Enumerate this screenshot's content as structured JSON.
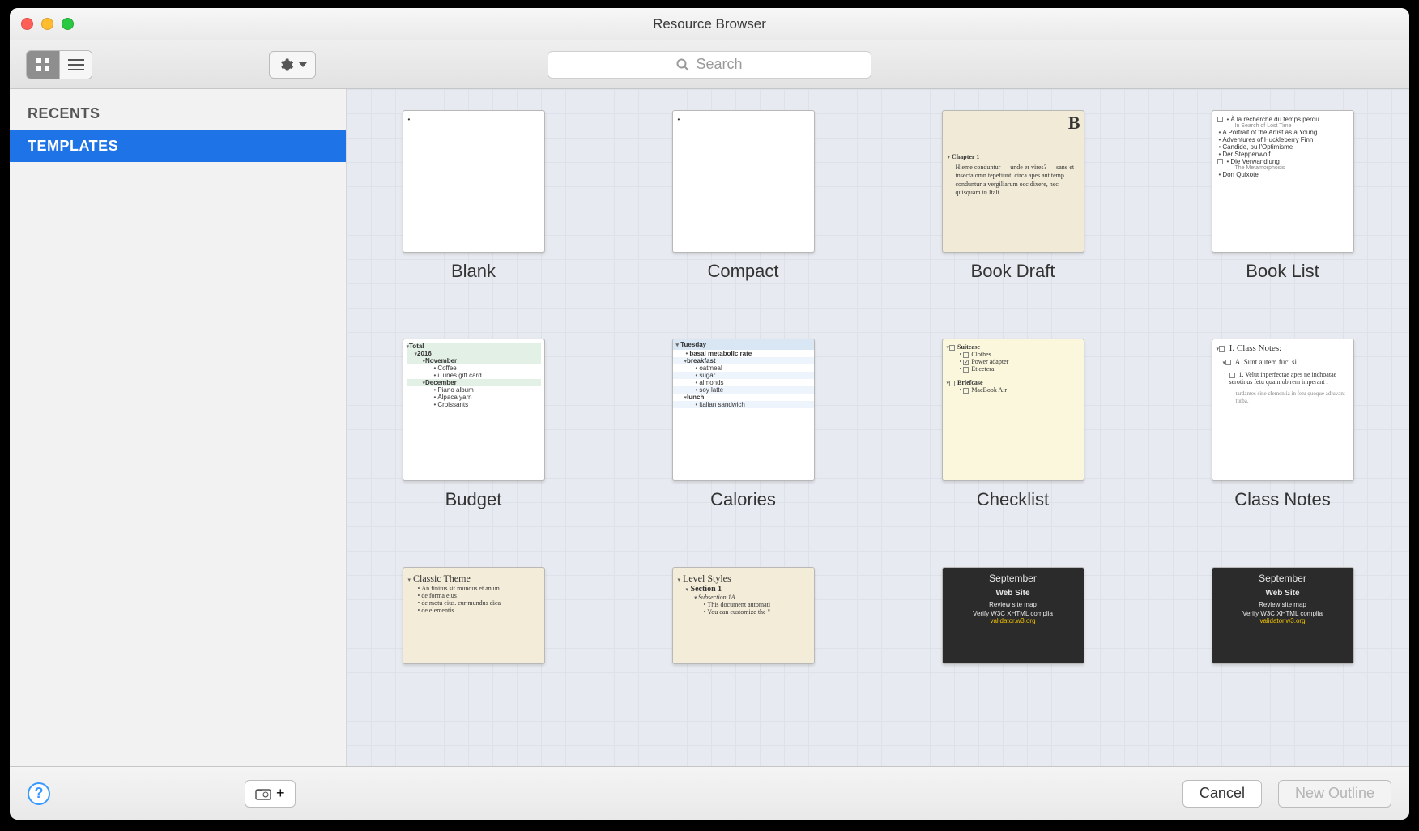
{
  "window": {
    "title": "Resource Browser"
  },
  "toolbar": {
    "search_placeholder": "Search"
  },
  "sidebar": {
    "items": [
      {
        "label": "RECENTS",
        "selected": false
      },
      {
        "label": "TEMPLATES",
        "selected": true
      }
    ]
  },
  "templates": [
    {
      "id": "blank",
      "title": "Blank"
    },
    {
      "id": "compact",
      "title": "Compact"
    },
    {
      "id": "book-draft",
      "title": "Book Draft",
      "preview": {
        "corner": "B",
        "chapter": "Chapter 1",
        "body": "Hieme conduntur — unde er vires? — sane et insecta omn tepefiunt. circa apes aut temp conduntur a vergiliarum occ dixere, nec quisquam in Itali"
      }
    },
    {
      "id": "book-list",
      "title": "Book List",
      "preview": {
        "items": [
          {
            "t": "À la recherche du temps perdu",
            "s": "In Search of Lost Time"
          },
          {
            "t": "A Portrait of the Artist as a Young"
          },
          {
            "t": "Adventures of Huckleberry Finn"
          },
          {
            "t": "Candide, ou l'Optimisme"
          },
          {
            "t": "Der Steppenwolf"
          },
          {
            "t": "Die Verwandlung",
            "s": "The Metamorphosis"
          },
          {
            "t": "Don Quixote"
          }
        ]
      }
    },
    {
      "id": "budget",
      "title": "Budget",
      "preview": {
        "root": "Total",
        "year": "2016",
        "months": [
          {
            "m": "November",
            "items": [
              "Coffee",
              "iTunes gift card"
            ]
          },
          {
            "m": "December",
            "items": [
              "Piano album",
              "Alpaca yarn",
              "Croissants"
            ]
          }
        ]
      }
    },
    {
      "id": "calories",
      "title": "Calories",
      "preview": {
        "day": "Tuesday",
        "lines": [
          "basal metabolic rate"
        ],
        "meals": [
          {
            "m": "breakfast",
            "foods": [
              "oatmeal",
              "sugar",
              "almonds",
              "soy latte"
            ]
          },
          {
            "m": "lunch",
            "foods": [
              "italian sandwich"
            ]
          }
        ]
      }
    },
    {
      "id": "checklist",
      "title": "Checklist",
      "preview": {
        "groups": [
          {
            "g": "Suitcase",
            "items": [
              {
                "t": "Clothes",
                "ck": false
              },
              {
                "t": "Power adapter",
                "ck": true
              },
              {
                "t": "Et cetera",
                "ck": false
              }
            ]
          },
          {
            "g": "Briefcase",
            "items": [
              {
                "t": "MacBook Air",
                "ck": false
              }
            ]
          }
        ]
      }
    },
    {
      "id": "class-notes",
      "title": "Class Notes",
      "preview": {
        "h1": "I. Class Notes:",
        "h2": "A. Sunt autem fuci si",
        "body1": "1. Velut inperfectae apes ne inchoatae serotinus fetu quam ob rem imperant i",
        "body2": "tardantes sine clementia in fetu quoque adiuvant turba."
      }
    },
    {
      "id": "classic",
      "title": "",
      "preview": {
        "h": "Classic Theme",
        "lines": [
          "An finitus sit mundus et an un",
          "de forma eius",
          "de motu eius. cur mundus dica",
          "de elementis"
        ]
      }
    },
    {
      "id": "level-styles",
      "title": "",
      "preview": {
        "h": "Level Styles",
        "sec": "Section 1",
        "sub": "Subsection 1A",
        "lines": [
          "This document automati",
          "You can customize the \""
        ]
      }
    },
    {
      "id": "dark1",
      "title": "",
      "preview": {
        "month": "September",
        "site": "Web Site",
        "task": "Review site map",
        "verify": "Verify W3C XHTML complia",
        "link": "validator.w3.org"
      }
    },
    {
      "id": "dark2",
      "title": "",
      "preview": {
        "month": "September",
        "site": "Web Site",
        "task": "Review site map",
        "verify": "Verify W3C XHTML complia",
        "link": "validator.w3.org"
      }
    }
  ],
  "footer": {
    "cancel": "Cancel",
    "new_outline": "New Outline"
  }
}
